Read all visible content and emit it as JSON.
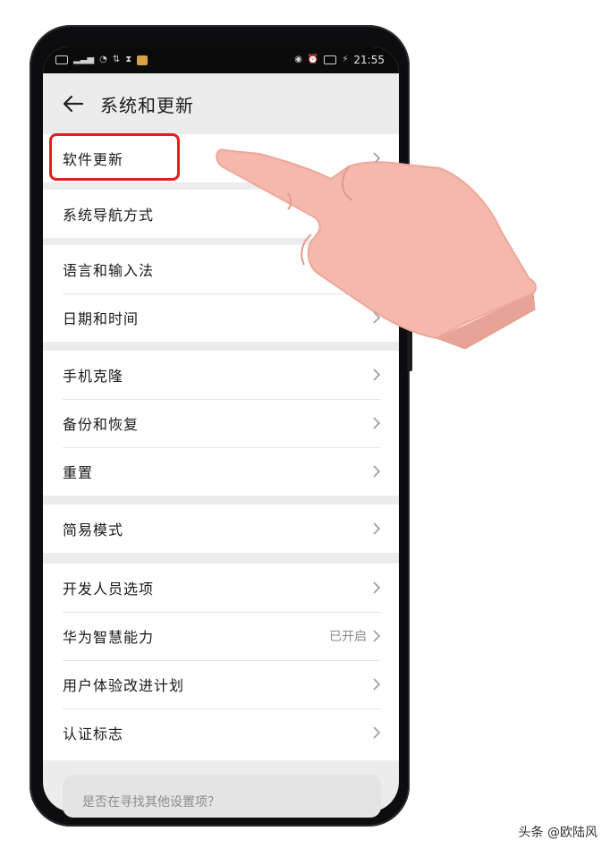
{
  "status_bar": {
    "time": "21:55"
  },
  "header": {
    "title": "系统和更新"
  },
  "groups": [
    {
      "items": [
        {
          "label": "软件更新"
        }
      ]
    },
    {
      "items": [
        {
          "label": "系统导航方式"
        }
      ]
    },
    {
      "items": [
        {
          "label": "语言和输入法"
        },
        {
          "label": "日期和时间"
        }
      ]
    },
    {
      "items": [
        {
          "label": "手机克隆"
        },
        {
          "label": "备份和恢复"
        },
        {
          "label": "重置"
        }
      ]
    },
    {
      "items": [
        {
          "label": "简易模式"
        }
      ]
    },
    {
      "items": [
        {
          "label": "开发人员选项"
        },
        {
          "label": "华为智慧能力",
          "value": "已开启"
        },
        {
          "label": "用户体验改进计划"
        },
        {
          "label": "认证标志"
        }
      ]
    }
  ],
  "search_hint": "是否在寻找其他设置项？",
  "watermark": "头条 @欧陆风",
  "colors": {
    "highlight": "#e02020",
    "hand": "#f4b8ad",
    "background": "#ececec"
  },
  "icons": [
    "back-arrow-icon",
    "chevron-right-icon",
    "signal-icon",
    "wifi-icon",
    "battery-icon"
  ]
}
